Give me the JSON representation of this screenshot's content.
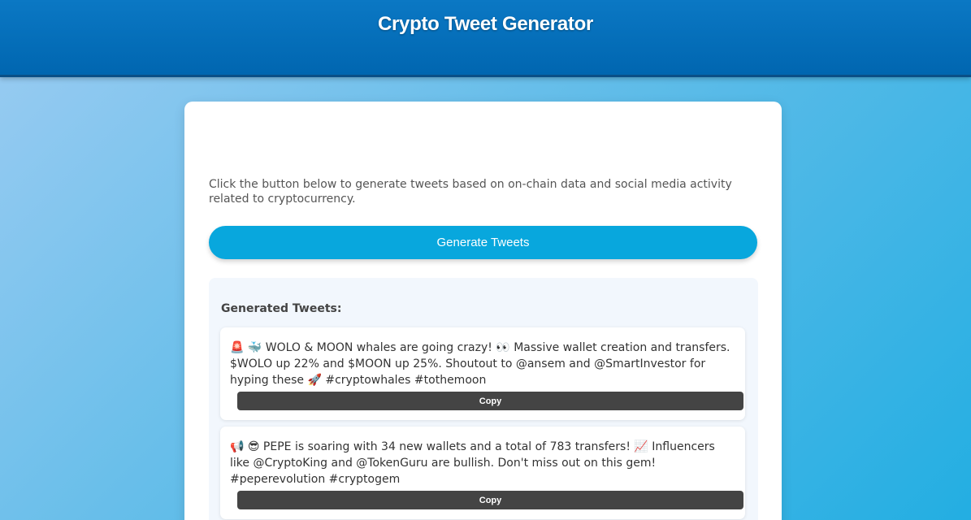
{
  "header": {
    "title": "Crypto Tweet Generator"
  },
  "main": {
    "intro": "Click the button below to generate tweets based on on-chain data and social media activity related to cryptocurrency.",
    "generate_label": "Generate Tweets",
    "results_title": "Generated Tweets:",
    "tweets": [
      {
        "text": "🚨 🐳 WOLO & MOON whales are going crazy! 👀 Massive wallet creation and transfers. $WOLO up 22% and $MOON up 25%. Shoutout to @ansem and @SmartInvestor for hyping these 🚀 #cryptowhales #tothemoon",
        "copy_label": "Copy"
      },
      {
        "text": "📢 😎 PEPE is soaring with 34 new wallets and a total of 783 transfers! 📈 Influencers like @CryptoKing and @TokenGuru are bullish. Don't miss out on this gem! #peperevolution #cryptogem",
        "copy_label": "Copy"
      }
    ]
  },
  "colors": {
    "header_bg": "#0066b0",
    "accent_button": "#08a7dd",
    "copy_button": "#444444",
    "results_bg": "#f2f7fd"
  }
}
